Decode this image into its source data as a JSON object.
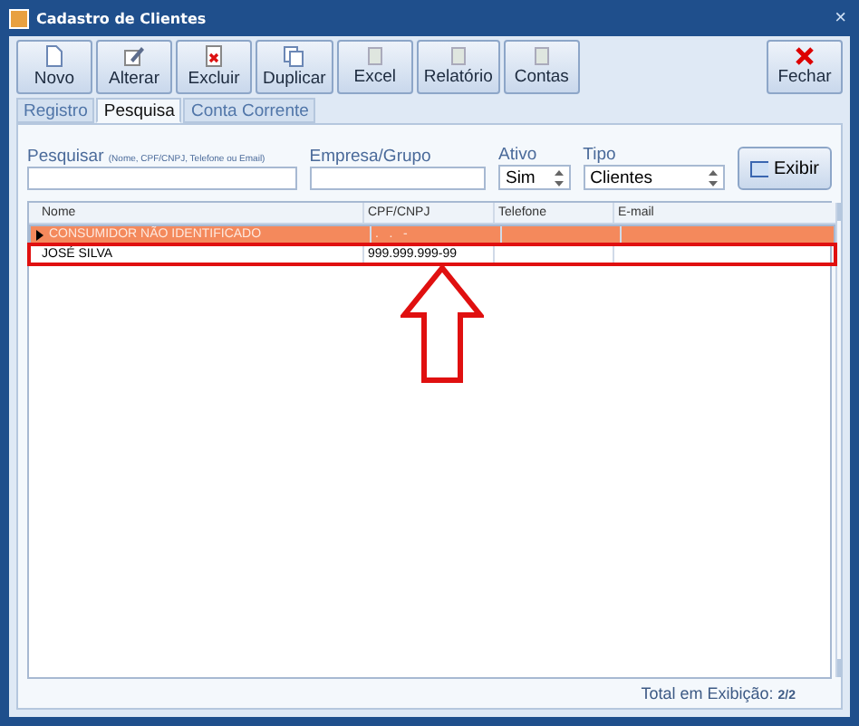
{
  "window": {
    "title": "Cadastro de Clientes",
    "close": "×"
  },
  "toolbar": [
    {
      "label": "Novo",
      "kind": "new"
    },
    {
      "label": "Alterar",
      "kind": "edit"
    },
    {
      "label": "Excluir",
      "kind": "delete"
    },
    {
      "label": "Duplicar",
      "kind": "copy"
    },
    {
      "label": "Excel",
      "kind": "export"
    },
    {
      "label": "Relatório",
      "kind": "export"
    },
    {
      "label": "Contas",
      "kind": "export"
    }
  ],
  "close_button": {
    "label": "Fechar"
  },
  "tabs": [
    {
      "label": "Registro",
      "selected": false
    },
    {
      "label": "Pesquisa",
      "selected": true
    },
    {
      "label": "Conta Corrente",
      "selected": false
    }
  ],
  "filters": {
    "search": {
      "label": "Pesquisar",
      "hint": "(Nome, CPF/CNPJ, Telefone ou Email)"
    },
    "company": {
      "label": "Empresa/Grupo"
    },
    "active": {
      "label": "Ativo",
      "value": "Sim"
    },
    "type": {
      "label": "Tipo",
      "value": "Clientes"
    },
    "show_button": "Exibir"
  },
  "table": {
    "columns": [
      "Nome",
      "CPF/CNPJ",
      "Telefone",
      "E-mail"
    ],
    "rows": [
      {
        "cells": [
          "CONSUMIDOR NÃO IDENTIFICADO",
          ".   .   -",
          "",
          ""
        ],
        "selected": true,
        "highlighted": false
      },
      {
        "cells": [
          "JOSÉ SILVA",
          "999.999.999-99",
          "",
          ""
        ],
        "selected": false,
        "highlighted": true
      }
    ]
  },
  "status_bar": {
    "label": "Total em Exibição:",
    "count": "2/2"
  }
}
